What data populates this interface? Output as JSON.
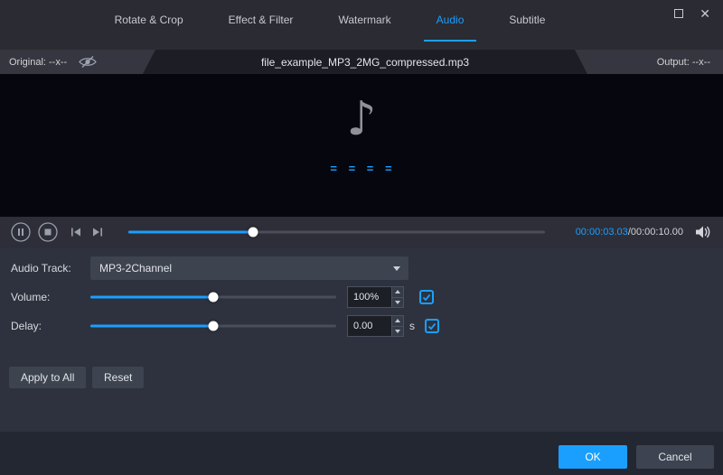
{
  "colors": {
    "accent": "#1a9fff"
  },
  "window_controls": {
    "close_icon": "✕"
  },
  "tabs": {
    "items": [
      {
        "label": "Rotate & Crop",
        "active": false
      },
      {
        "label": "Effect & Filter",
        "active": false
      },
      {
        "label": "Watermark",
        "active": false
      },
      {
        "label": "Audio",
        "active": true
      },
      {
        "label": "Subtitle",
        "active": false
      }
    ]
  },
  "info_bar": {
    "original_label": "Original: --x--",
    "filename": "file_example_MP3_2MG_compressed.mp3",
    "output_label": "Output: --x--"
  },
  "preview": {
    "note_glyph": "♪",
    "equalizer_text": "= = = ="
  },
  "transport": {
    "current_time": "00:00:03.03",
    "time_separator": "/",
    "total_time": "00:00:10.00",
    "progress_position": "30%"
  },
  "panel": {
    "audio_track_label": "Audio Track:",
    "audio_track_value": "MP3-2Channel",
    "volume_label": "Volume:",
    "volume_value": "100%",
    "volume_position": "50%",
    "delay_label": "Delay:",
    "delay_value": "0.00",
    "delay_unit": "s",
    "delay_position": "50%",
    "apply_to_all_label": "Apply to All",
    "reset_label": "Reset"
  },
  "footer": {
    "ok_label": "OK",
    "cancel_label": "Cancel"
  }
}
